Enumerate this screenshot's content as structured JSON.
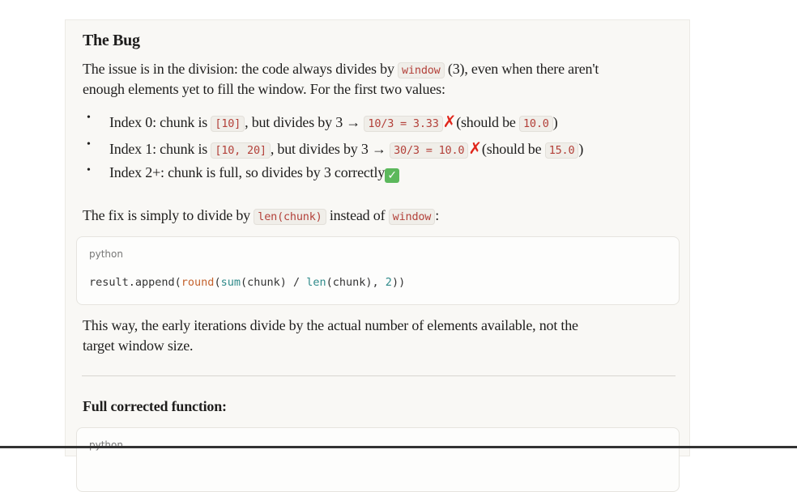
{
  "heading": "The Bug",
  "intro": {
    "before": "The issue is in the division: the code always divides by ",
    "code": "window",
    "after": " (3), even when there aren't",
    "line2": "enough elements yet to fill the window. For the first two values:"
  },
  "bullets": [
    {
      "a": "Index 0: chunk is ",
      "c1": "[10]",
      "b": ", but divides by 3 → ",
      "c2": "10/3 = 3.33",
      "mark": "✗",
      "d": "(should be ",
      "c3": "10.0",
      "e": ")"
    },
    {
      "a": "Index 1: chunk is ",
      "c1": "[10, 20]",
      "b": ", but divides by 3 → ",
      "c2": "30/3 = 10.0",
      "mark": "✗",
      "d": "(should be ",
      "c3": "15.0",
      "e": ")"
    },
    {
      "a": "Index 2+: chunk is full, so divides by 3 correctly",
      "check": "✓"
    }
  ],
  "fix": {
    "before": "The fix is simply to divide by ",
    "code1": "len(chunk)",
    "mid": " instead of ",
    "code2": "window",
    "after": ":"
  },
  "codeblock1": {
    "lang": "python",
    "t1": "result.append(",
    "t2": "round",
    "t3": "(",
    "t4": "sum",
    "t5": "(chunk) / ",
    "t6": "len",
    "t7": "(chunk), ",
    "t8": "2",
    "t9": "))"
  },
  "explain": {
    "line1": "This way, the early iterations divide by the actual number of elements available, not the",
    "line2": "target window size."
  },
  "heading2": "Full corrected function:",
  "codeblock2": {
    "lang": "python"
  }
}
